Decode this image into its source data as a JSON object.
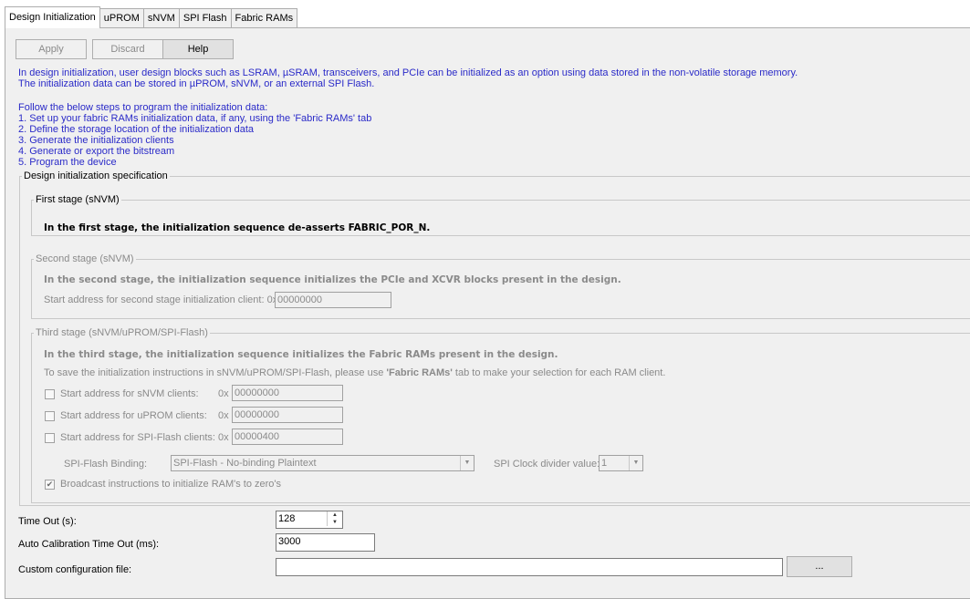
{
  "tabs": [
    "Design Initialization",
    "uPROM",
    "sNVM",
    "SPI Flash",
    "Fabric RAMs"
  ],
  "toolbar": {
    "apply": "Apply",
    "discard": "Discard",
    "help": "Help"
  },
  "intro": {
    "line1": "In design initialization, user design blocks such as LSRAM, µSRAM, transceivers, and PCIe can be initialized as an option using data stored in the non-volatile storage memory.",
    "line2": "The initialization data can be stored in µPROM, sNVM, or an external SPI Flash.",
    "steps_header": "Follow the below steps to program the initialization data:",
    "steps": [
      "1. Set up your fabric RAMs initialization data, if any, using the 'Fabric RAMs' tab",
      "2. Define the storage location of the initialization data",
      "3. Generate the initialization clients",
      "4. Generate or export the bitstream",
      "5. Program the device"
    ]
  },
  "spec": {
    "legend": "Design initialization specification",
    "first": {
      "legend": "First stage (sNVM)",
      "text": "In the first stage, the initialization sequence de-asserts FABRIC_POR_N."
    },
    "second": {
      "legend": "Second stage (sNVM)",
      "text": "In the second stage, the initialization sequence initializes the PCIe and XCVR blocks present in the design.",
      "addr_label": "Start address for second stage initialization client:  0x",
      "addr_value": "00000000"
    },
    "third": {
      "legend": "Third stage (sNVM/uPROM/SPI-Flash)",
      "text": "In the third stage, the initialization sequence initializes the Fabric RAMs present in the design.",
      "hint_pre": "To save the initialization instructions in sNVM/uPROM/SPI-Flash, please use ",
      "hint_bold": "'Fabric RAMs'",
      "hint_post": " tab to make your selection for each RAM client.",
      "snvm_label": "Start address for sNVM clients:",
      "snvm_value": "00000000",
      "uprom_label": "Start address for uPROM clients:",
      "uprom_value": "00000000",
      "spi_label": "Start address for SPI-Flash clients:",
      "spi_value": "00000400",
      "hex_prefix": "0x",
      "binding_label": "SPI-Flash Binding:",
      "binding_value": "SPI-Flash - No-binding Plaintext",
      "clock_label": "SPI Clock divider value:",
      "clock_value": "1",
      "broadcast_label": "Broadcast instructions to initialize RAM's to zero's",
      "broadcast_checked": true
    }
  },
  "timeout": {
    "label": "Time Out (s):",
    "value": "128"
  },
  "autocal": {
    "label": "Auto Calibration Time Out (ms):",
    "value": "3000"
  },
  "custom": {
    "label": "Custom configuration file:",
    "value": "",
    "browse": "..."
  }
}
